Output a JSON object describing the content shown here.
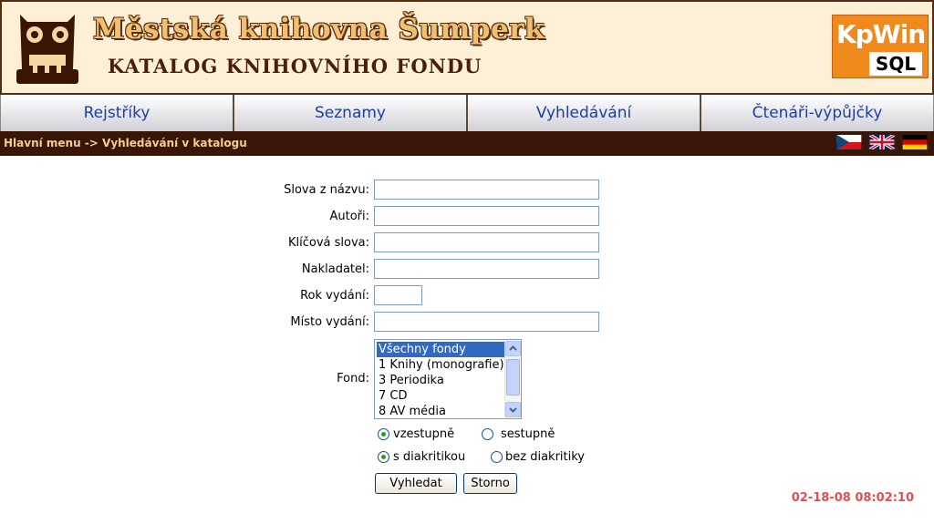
{
  "header": {
    "library_title": "Městská knihovna Šumperk",
    "catalog_title": "KATALOG KNIHOVNÍHO FONDU",
    "logo_kp": "KpWin",
    "logo_sql": "SQL"
  },
  "nav": {
    "items": [
      {
        "label": "Rejstříky"
      },
      {
        "label": "Seznamy"
      },
      {
        "label": "Vyhledávání"
      },
      {
        "label": "Čtenáři-výpůjčky"
      }
    ]
  },
  "breadcrumb": "Hlavní menu -> Vyhledávání v katalogu",
  "form": {
    "title_words_label": "Slova z názvu:",
    "title_words_value": "",
    "authors_label": "Autoři:",
    "authors_value": "",
    "keywords_label": "Klíčová slova:",
    "keywords_value": "",
    "publisher_label": "Nakladatel:",
    "publisher_value": "",
    "year_label": "Rok vydání:",
    "year_value": "",
    "place_label": "Místo vydání:",
    "place_value": "",
    "fund_label": "Fond:",
    "fund_options": [
      {
        "label": "Všechny fondy",
        "selected": true
      },
      {
        "label": "1 Knihy (monografie)",
        "selected": false
      },
      {
        "label": "3 Periodika",
        "selected": false
      },
      {
        "label": "7 CD",
        "selected": false
      },
      {
        "label": "8 AV média",
        "selected": false
      }
    ],
    "sort": {
      "ascending": "vzestupně",
      "descending": "sestupně",
      "selected": "ascending"
    },
    "diacritics": {
      "with": "s diakritikou",
      "without": "bez diakritiky",
      "selected": "with"
    },
    "search_button": "Vyhledat",
    "cancel_button": "Storno"
  },
  "timestamp": "02-18-08 08:02:10",
  "colors": {
    "header_bg": "#fdf0d6",
    "brown": "#3a1404",
    "nav_text": "#1a3fa0",
    "timestamp": "#e05050",
    "logo_orange": "#f08a1c"
  }
}
